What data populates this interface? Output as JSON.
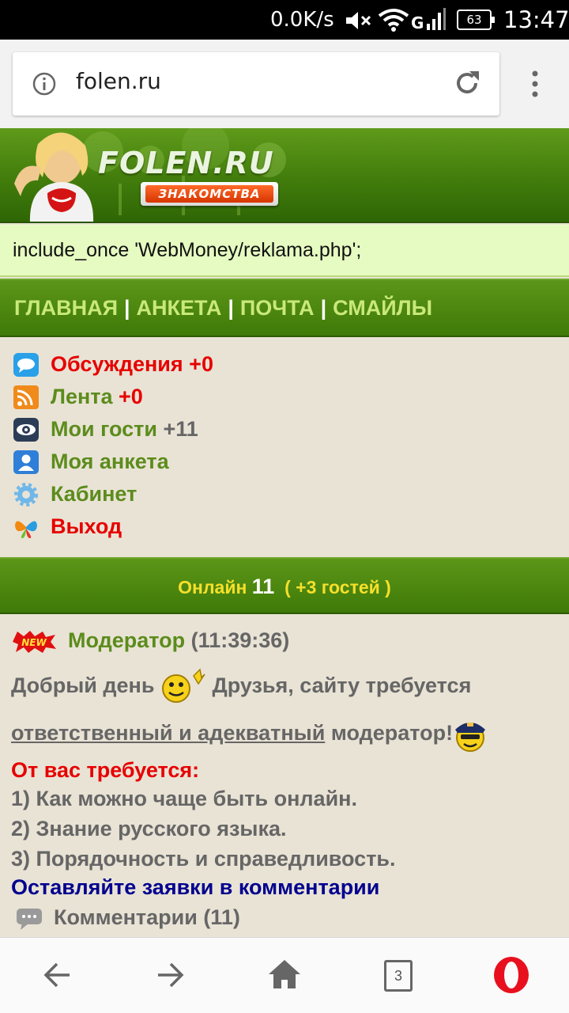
{
  "status_bar": {
    "network_speed": "0.0K/s",
    "battery": "63",
    "time": "13:47",
    "icons": [
      "mute-icon",
      "wifi-icon",
      "signal-icon",
      "battery-icon"
    ]
  },
  "browser": {
    "url": "folen.ru",
    "tab_count": "3"
  },
  "header": {
    "logo": "FOLEN.RU",
    "badge": "ЗНАКОМСТВА"
  },
  "reklama": {
    "text": "include_once 'WebMoney/reklama.php';"
  },
  "nav": {
    "items": [
      "ГЛАВНАЯ",
      "АНКЕТА",
      "ПОЧТА",
      "СМАЙЛЫ"
    ],
    "separator": "|"
  },
  "menu": {
    "discussions": {
      "label": "Обсуждения",
      "count": "+0"
    },
    "feed": {
      "label": "Лента",
      "count": "+0"
    },
    "guests": {
      "label": "Мои гости",
      "count": "+11"
    },
    "profile": {
      "label": "Моя анкета"
    },
    "cabinet": {
      "label": "Кабинет"
    },
    "logout": {
      "label": "Выход"
    }
  },
  "online": {
    "label": "Онлайн",
    "count": "11",
    "guests_open": "( +3",
    "guests_label": "гостей )"
  },
  "post": {
    "badge": "NEW",
    "author": "Модератор",
    "time": "(11:39:36)",
    "line1_a": "Добрый день",
    "line1_b": "Друзья, сайту требуется",
    "line2_u": "ответственный и адекватный",
    "line2_b": "модератор!",
    "req_title": "От вас требуется:",
    "req1": "1) Как можно чаще быть онлайн.",
    "req2": "2) Знание русского языка.",
    "req3": "3) Порядочность и справедливость.",
    "cta": "Оставляйте заявки в комментарии",
    "comments": "Комментарии (11)"
  },
  "colors": {
    "green": "#5c8c1c",
    "red": "#e60000",
    "nav_text": "#c9e97a",
    "online_text": "#f5e02a",
    "cta": "#00008f"
  }
}
